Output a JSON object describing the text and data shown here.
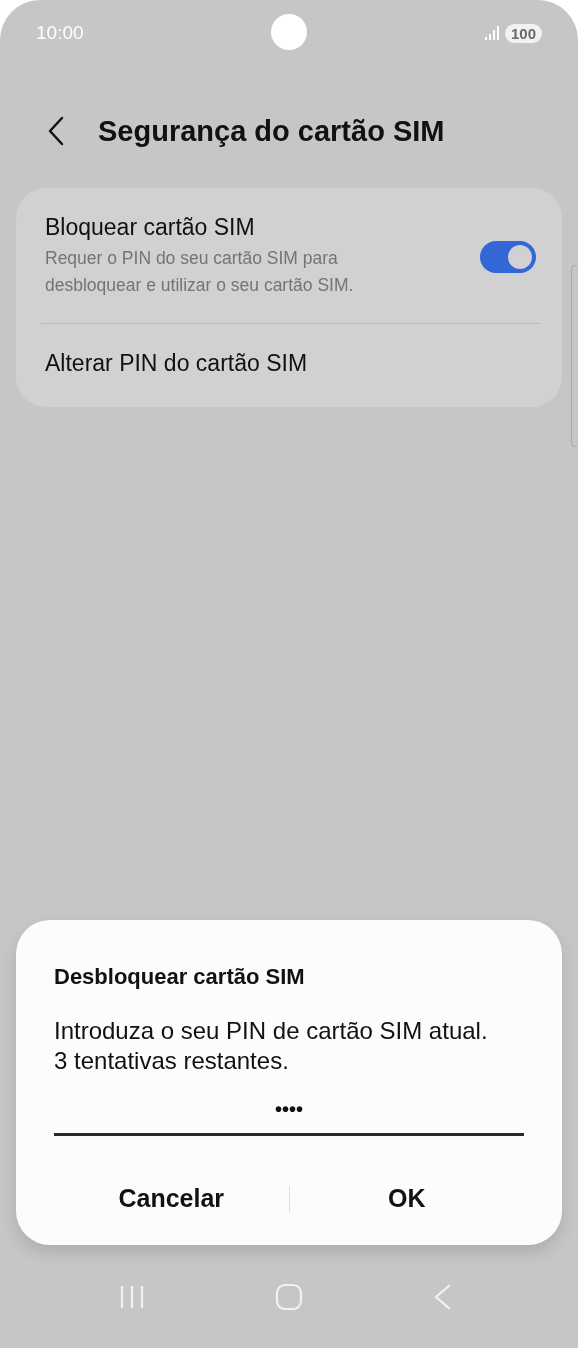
{
  "status_bar": {
    "time": "10:00",
    "battery": "100"
  },
  "header": {
    "title": "Segurança do cartão SIM"
  },
  "settings": [
    {
      "kind": "toggle",
      "title": "Bloquear cartão SIM",
      "subtitle": "Requer o PIN do seu cartão SIM para desbloquear e utilizar o seu cartão SIM.",
      "on": true
    },
    {
      "kind": "link",
      "title": "Alterar PIN do cartão SIM"
    }
  ],
  "dialog": {
    "title": "Desbloquear cartão SIM",
    "message": "Introduza o seu PIN de cartão SIM atual.",
    "attempts": "3 tentativas restantes.",
    "pin_value": "••••",
    "buttons": [
      "Cancelar",
      "OK"
    ]
  }
}
